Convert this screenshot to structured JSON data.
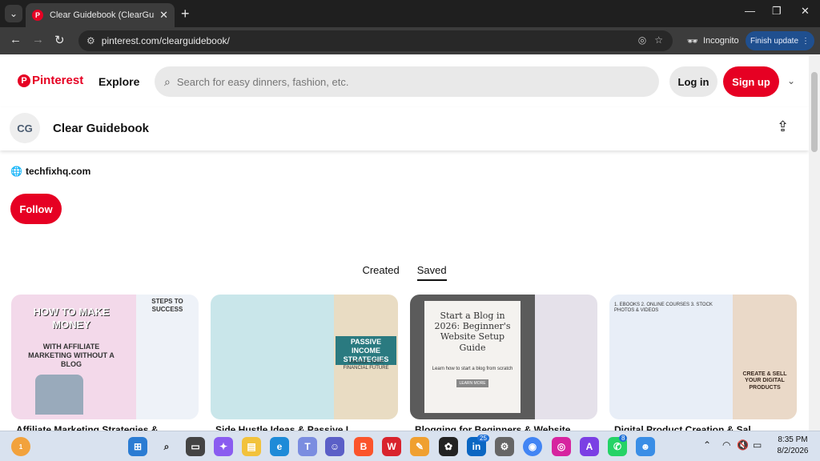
{
  "browser": {
    "tab_title": "Clear Guidebook (ClearGuidebo",
    "url": "pinterest.com/clearguidebook/",
    "incognito_label": "Incognito",
    "finish_update_label": "Finish update"
  },
  "header": {
    "logo": "Pinterest",
    "explore": "Explore",
    "search_placeholder": "Search for easy dinners, fashion, etc.",
    "login": "Log in",
    "signup": "Sign up"
  },
  "profile": {
    "avatar_initials": "CG",
    "name": "Clear Guidebook",
    "website": "techfixhq.com",
    "follow": "Follow"
  },
  "tabs": {
    "created": "Created",
    "saved": "Saved"
  },
  "pins": [
    {
      "caption": "Affiliate Marketing Strategies &",
      "headline": "HOW TO MAKE MONEY",
      "sub": "WITH AFFILIATE MARKETING WITHOUT A BLOG",
      "side": "STEPS TO SUCCESS"
    },
    {
      "caption": "Side Hustle Ideas & Passive I",
      "headline": "PASSIVE INCOME STRATEGIES",
      "sub": "UNLOCK YOUR FINANCIAL FUTURE",
      "side": ""
    },
    {
      "caption": "Blogging for Beginners & Website",
      "headline": "Start a Blog in 2026: Beginner's Website Setup Guide",
      "sub": "Learn how to start a blog from scratch",
      "side": "LEARN MORE"
    },
    {
      "caption": "Digital Product Creation & Sal",
      "headline": "CREATE & SELL YOUR DIGITAL PRODUCTS",
      "sub": "1. EBOOKS  2. ONLINE COURSES  3. STOCK PHOTOS & VIDEOS",
      "side": ""
    }
  ],
  "taskbar": {
    "time": "8:35 PM",
    "date": "8/2/2026",
    "linkedin_badge": "25",
    "whatsapp_badge": "8",
    "weather_badge": "1"
  },
  "colors": {
    "brand_red": "#e60023"
  }
}
